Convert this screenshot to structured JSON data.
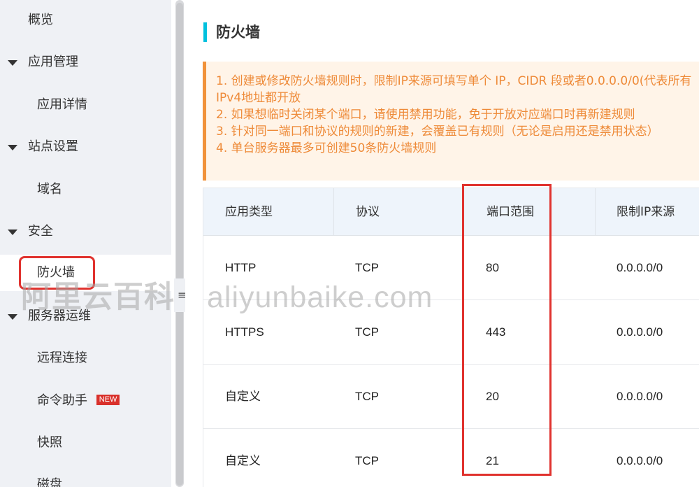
{
  "sidebar": {
    "items": [
      {
        "label": "概览",
        "level": "top",
        "expandable": false
      },
      {
        "label": "应用管理",
        "level": "top",
        "expandable": true
      },
      {
        "label": "应用详情",
        "level": "sub"
      },
      {
        "label": "站点设置",
        "level": "top",
        "expandable": true
      },
      {
        "label": "域名",
        "level": "sub"
      },
      {
        "label": "安全",
        "level": "top",
        "expandable": true
      },
      {
        "label": "防火墙",
        "level": "sub",
        "active": true
      },
      {
        "label": "服务器运维",
        "level": "top",
        "expandable": true
      },
      {
        "label": "远程连接",
        "level": "sub"
      },
      {
        "label": "命令助手",
        "level": "sub",
        "badge": "NEW"
      },
      {
        "label": "快照",
        "level": "sub"
      },
      {
        "label": "磁盘",
        "level": "sub"
      }
    ]
  },
  "page": {
    "title": "防火墙"
  },
  "notice": {
    "lines": [
      "1. 创建或修改防火墙规则时，限制IP来源可填写单个 IP，CIDR 段或者0.0.0.0/0(代表所有",
      "IPv4地址都开放",
      "2. 如果想临时关闭某个端口，请使用禁用功能，免于开放对应端口时再新建规则",
      "3. 针对同一端口和协议的规则的新建，会覆盖已有规则（无论是启用还是禁用状态）",
      "4. 单台服务器最多可创建50条防火墙规则"
    ]
  },
  "table": {
    "headers": [
      "应用类型",
      "协议",
      "端口范围",
      "限制IP来源"
    ],
    "rows": [
      [
        "HTTP",
        "TCP",
        "80",
        "0.0.0.0/0"
      ],
      [
        "HTTPS",
        "TCP",
        "443",
        "0.0.0.0/0"
      ],
      [
        "自定义",
        "TCP",
        "20",
        "0.0.0.0/0"
      ],
      [
        "自定义",
        "TCP",
        "21",
        "0.0.0.0/0"
      ]
    ]
  },
  "watermark": {
    "cn": "阿里云百科",
    "domain": "aliyunbaike.com"
  },
  "collapse": {
    "icon": "≡"
  },
  "colors": {
    "accent": "#00c1de",
    "notice_text": "#ee8a38",
    "notice_border": "#f1923a",
    "highlight": "#e0322e",
    "badge": "#d9312b"
  }
}
